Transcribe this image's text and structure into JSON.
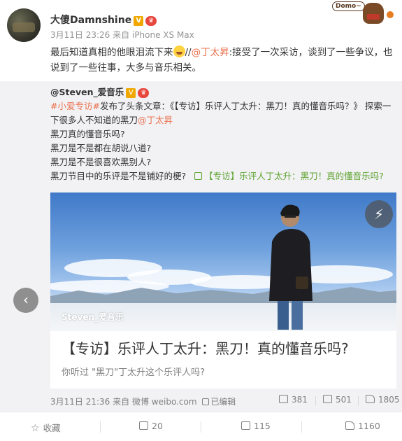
{
  "post": {
    "username": "大傻Damnshine",
    "badge_v": "V",
    "badge_crown": "♛",
    "timestamp": "3月11日 23:26",
    "source_prefix": "来自",
    "source": "iPhone XS Max",
    "text_before_emoji": "最后知道真相的他眼泪流下来",
    "text_repost_sep": "//",
    "mention": "@丁太昇",
    "text_after_mention": ":接受了一次采访，谈到了一些争议，也说到了一些往事，大多与音乐相关。",
    "sticker_text": "Domo~"
  },
  "repost": {
    "author": "@Steven_爱音乐",
    "topic": "#小爱专访#",
    "published": "发布了头条文章：《【专访】乐评人丁太升：黑刀！真的懂音乐吗？》 探索一下很多人不知道的黑刀",
    "mention": "@丁太昇",
    "line_q1": "黑刀真的懂音乐吗?",
    "line_q2": "黑刀是不是都在胡说八道?",
    "line_q3": "黑刀是不是很喜欢黑别人?",
    "line_q4": "黑刀节目中的乐评是不是铺好的梗?",
    "article_link": "【专访】乐评人丁太升：黑刀！真的懂音乐吗?",
    "card": {
      "watermark": "Steven_爱音乐",
      "title": "【专访】乐评人丁太升：黑刀！真的懂音乐吗?",
      "description": "你听过 \"黑刀\"丁太升这个乐评人吗?",
      "flash_icon": "lightning-icon"
    },
    "footer": {
      "timestamp": "3月11日 21:36",
      "source_prefix": "来自",
      "source": "微博 weibo.com",
      "edited": "已编辑",
      "reposts": "381",
      "comments": "501",
      "likes": "1805"
    }
  },
  "actions": {
    "favorite_label": "收藏",
    "repost_count": "20",
    "comment_count": "115",
    "like_count": "1160"
  },
  "colors": {
    "accent_orange": "#eb7350",
    "link_green": "#5ea32f",
    "repost_bg": "#f2f2f5",
    "meta_gray": "#939393"
  }
}
